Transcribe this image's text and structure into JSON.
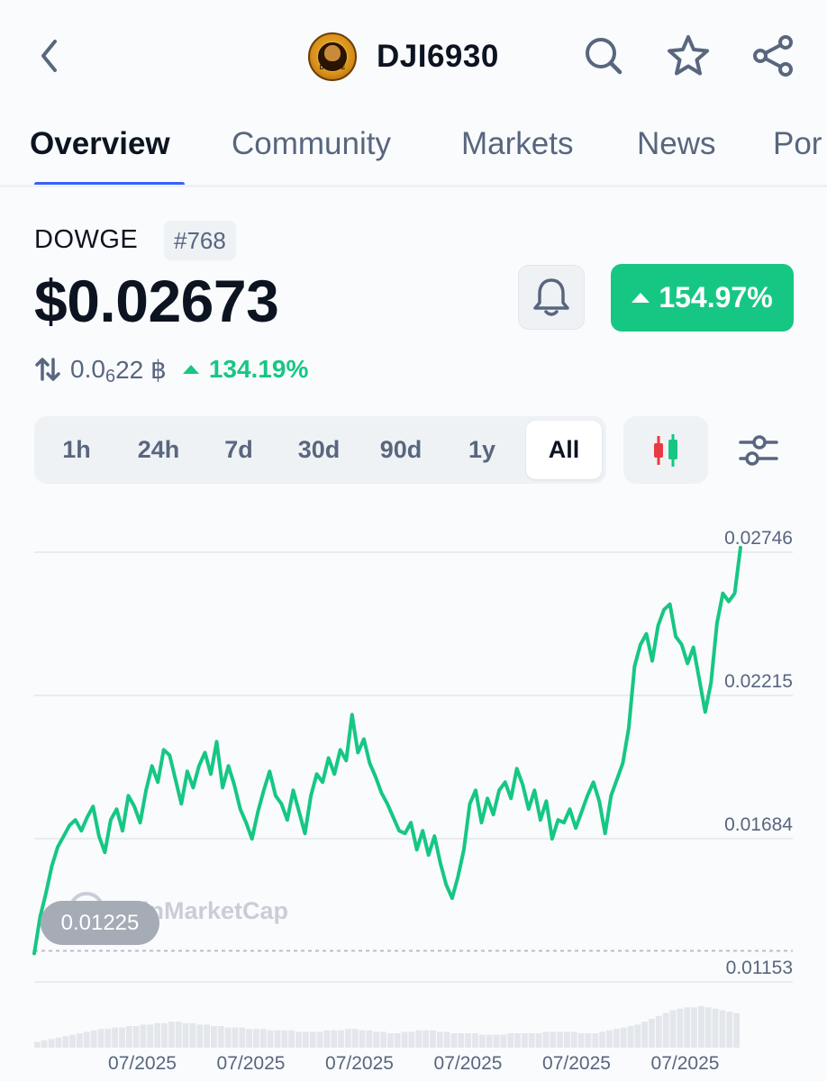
{
  "header": {
    "coin_symbol": "DJI6930",
    "logo_text": "DOWGE",
    "icons": [
      "chevron-left-icon",
      "search-icon",
      "star-icon",
      "share-icon"
    ]
  },
  "tabs": [
    {
      "label": "Overview",
      "active": true
    },
    {
      "label": "Community",
      "active": false
    },
    {
      "label": "Markets",
      "active": false
    },
    {
      "label": "News",
      "active": false
    },
    {
      "label": "Por",
      "active": false
    }
  ],
  "asset": {
    "name": "DOWGE",
    "rank": "#768",
    "price": "$0.02673",
    "change_24h": "154.97%",
    "btc_price_main": "0.0",
    "btc_price_sub": "6",
    "btc_price_tail": "22 ฿",
    "btc_change": "134.19%"
  },
  "time_ranges": [
    {
      "label": "1h",
      "active": false
    },
    {
      "label": "24h",
      "active": false
    },
    {
      "label": "7d",
      "active": false
    },
    {
      "label": "30d",
      "active": false
    },
    {
      "label": "90d",
      "active": false
    },
    {
      "label": "1y",
      "active": false
    },
    {
      "label": "All",
      "active": true
    }
  ],
  "colors": {
    "up_green": "#16c784",
    "down_red": "#ea3943",
    "accent_blue": "#3861fb",
    "text_primary": "#0d1421",
    "text_secondary": "#58667e"
  },
  "chart_data": {
    "type": "line",
    "watermark": "CoinMarketCap",
    "start_value_label": "0.01225",
    "y_ticks": [
      "0.02746",
      "0.02215",
      "0.01684",
      "0.01153"
    ],
    "ylim": [
      0.01153,
      0.02746
    ],
    "x_tick_labels": [
      "07/2025",
      "07/2025",
      "07/2025",
      "07/2025",
      "07/2025",
      "07/2025"
    ],
    "values": [
      0.01225,
      0.0136,
      0.0145,
      0.0155,
      0.0162,
      0.0166,
      0.017,
      0.0172,
      0.0168,
      0.0173,
      0.0177,
      0.0166,
      0.016,
      0.0172,
      0.0176,
      0.0168,
      0.0181,
      0.0177,
      0.0171,
      0.0183,
      0.0192,
      0.0186,
      0.0198,
      0.0196,
      0.0187,
      0.0178,
      0.019,
      0.0184,
      0.0192,
      0.0197,
      0.0189,
      0.0201,
      0.0184,
      0.0192,
      0.0185,
      0.0176,
      0.0171,
      0.0165,
      0.0175,
      0.0183,
      0.019,
      0.0181,
      0.0178,
      0.0172,
      0.0183,
      0.0175,
      0.0167,
      0.0181,
      0.0189,
      0.0186,
      0.0195,
      0.0189,
      0.0198,
      0.0194,
      0.0211,
      0.0197,
      0.0202,
      0.0193,
      0.0188,
      0.0182,
      0.0178,
      0.0173,
      0.0168,
      0.0167,
      0.0171,
      0.0161,
      0.0168,
      0.0159,
      0.0166,
      0.0156,
      0.0148,
      0.0143,
      0.0151,
      0.0161,
      0.0178,
      0.0183,
      0.0171,
      0.018,
      0.0174,
      0.0183,
      0.0186,
      0.018,
      0.0191,
      0.0185,
      0.0176,
      0.0183,
      0.0172,
      0.0179,
      0.0165,
      0.0172,
      0.0171,
      0.0176,
      0.0169,
      0.0175,
      0.0181,
      0.0186,
      0.0179,
      0.0167,
      0.0181,
      0.0187,
      0.0193,
      0.0206,
      0.0229,
      0.0237,
      0.0241,
      0.0231,
      0.0244,
      0.025,
      0.0252,
      0.024,
      0.0237,
      0.023,
      0.0236,
      0.0224,
      0.0212,
      0.0223,
      0.0245,
      0.0256,
      0.0253,
      0.0256,
      0.0273
    ],
    "volume_profile": [
      4,
      5,
      6,
      7,
      8,
      9,
      10,
      11,
      12,
      13,
      13,
      14,
      14,
      15,
      15,
      16,
      16,
      17,
      17,
      18,
      18,
      17,
      17,
      16,
      16,
      15,
      15,
      14,
      14,
      14,
      13,
      13,
      13,
      12,
      12,
      12,
      12,
      11,
      11,
      11,
      11,
      12,
      12,
      12,
      13,
      13,
      12,
      12,
      11,
      11,
      10,
      10,
      11,
      11,
      12,
      12,
      12,
      11,
      11,
      10,
      10,
      10,
      10,
      9,
      9,
      9,
      9,
      10,
      10,
      10,
      10,
      10,
      11,
      11,
      11,
      11,
      11,
      10,
      10,
      10,
      11,
      12,
      13,
      14,
      15,
      16,
      18,
      20,
      22,
      24,
      26,
      27,
      28,
      28,
      29,
      28,
      27,
      26,
      25,
      24
    ]
  }
}
